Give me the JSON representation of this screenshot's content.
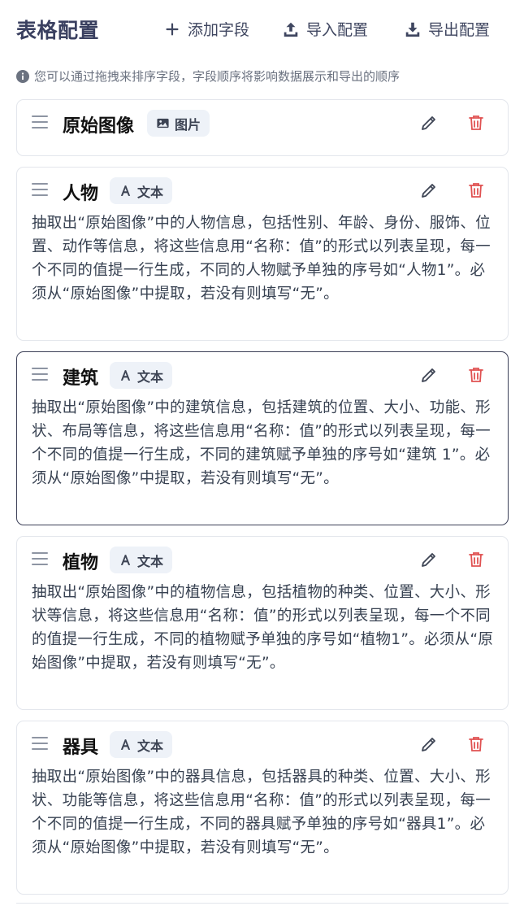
{
  "header": {
    "title": "表格配置",
    "add_label": "添加字段",
    "import_label": "导入配置",
    "export_label": "导出配置"
  },
  "hint": {
    "icon": "info-icon",
    "text": "您可以通过拖拽来排序字段，字段顺序将影响数据展示和导出的顺序"
  },
  "icons": {
    "drag": "drag-handle-icon",
    "edit": "pencil-icon",
    "delete": "trash-icon",
    "image_type": "image-icon",
    "text_type": "letter-a-icon"
  },
  "colors": {
    "title": "#3a4060",
    "delete": "#e05252",
    "badge_bg": "#eef2f8",
    "active_border": "#3b3f57"
  },
  "fields": [
    {
      "name": "原始图像",
      "type": "图片",
      "description": ""
    },
    {
      "name": "人物",
      "type": "文本",
      "description": "抽取出“原始图像”中的人物信息，包括性别、年龄、身份、服饰、位置、动作等信息，将这些信息用“名称：值”的形式以列表呈现，每一个不同的值提一行生成，不同的人物赋予单独的序号如“人物1”。必须从“原始图像”中提取，若没有则填写“无”。"
    },
    {
      "name": "建筑",
      "type": "文本",
      "description": "抽取出“原始图像”中的建筑信息，包括建筑的位置、大小、功能、形状、布局等信息，将这些信息用“名称：值”的形式以列表呈现，每一个不同的值提一行生成，不同的建筑赋予单独的序号如“建筑 1”。必须从“原始图像”中提取，若没有则填写“无”。"
    },
    {
      "name": "植物",
      "type": "文本",
      "description": "抽取出“原始图像”中的植物信息，包括植物的种类、位置、大小、形状等信息，将这些信息用“名称：值”的形式以列表呈现，每一个不同的值提一行生成，不同的植物赋予单独的序号如“植物1”。必须从“原始图像”中提取，若没有则填写“无”。"
    },
    {
      "name": "器具",
      "type": "文本",
      "description": "抽取出“原始图像”中的器具信息，包括器具的种类、位置、大小、形状、功能等信息，将这些信息用“名称：值”的形式以列表呈现，每一个不同的值提一行生成，不同的器具赋予单独的序号如“器具1”。必须从“原始图像”中提取，若没有则填写“无”。"
    }
  ]
}
